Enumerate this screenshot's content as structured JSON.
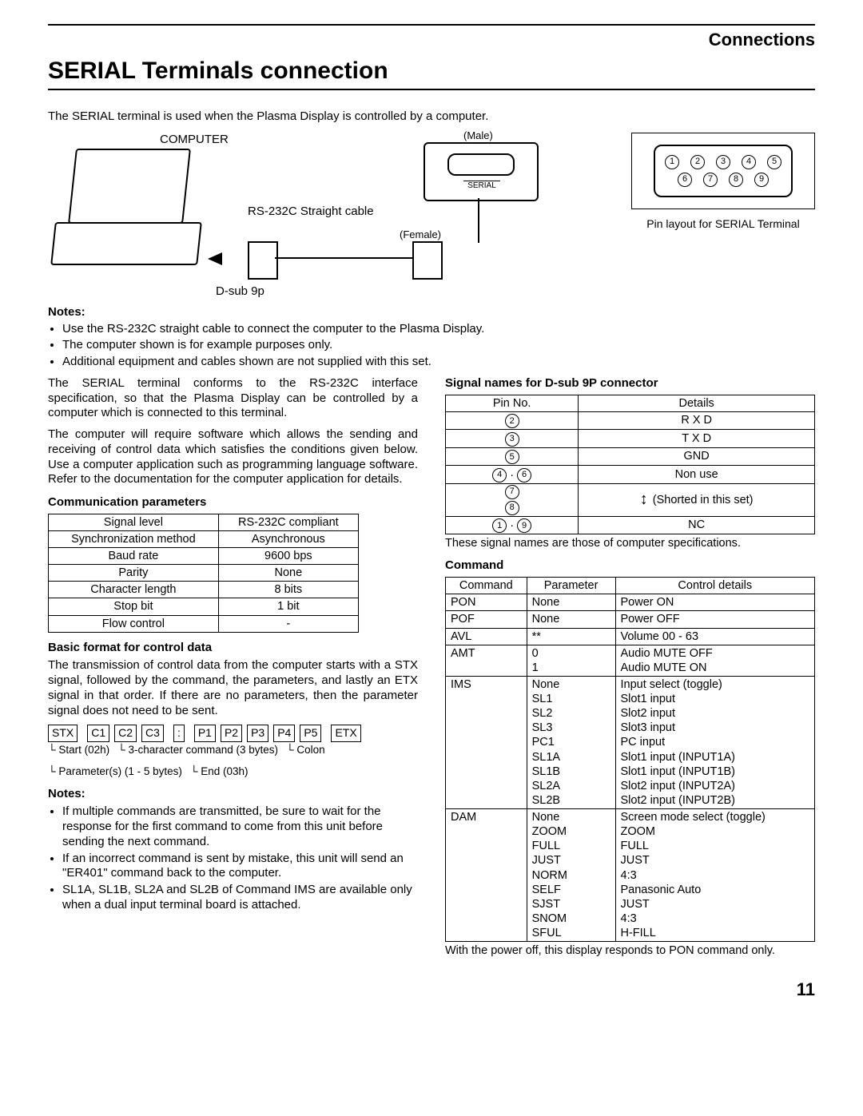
{
  "header": {
    "section": "Connections",
    "title": "SERIAL Terminals connection"
  },
  "intro_text": "The SERIAL terminal is used when the Plasma Display is controlled by a computer.",
  "diagram": {
    "computer_label": "COMPUTER",
    "male_label": "(Male)",
    "serial_label": "SERIAL",
    "cable_label": "RS-232C Straight cable",
    "female_label": "(Female)",
    "dsub_label": "D-sub 9p",
    "pin_caption": "Pin layout for SERIAL Terminal",
    "pins_top": [
      "1",
      "2",
      "3",
      "4",
      "5"
    ],
    "pins_bottom": [
      "6",
      "7",
      "8",
      "9"
    ]
  },
  "notes1_header": "Notes:",
  "notes1": [
    "Use the RS-232C straight cable to connect the computer to the Plasma Display.",
    "The computer shown is for example purposes only.",
    "Additional equipment and cables shown are not supplied with this set."
  ],
  "left_paras": [
    "The SERIAL terminal conforms to the RS-232C interface specification, so that the Plasma Display can be controlled by a computer which is connected to this terminal.",
    "The computer will require software which allows the sending and receiving of control data which satisfies the conditions given below. Use a computer application such as programming language software. Refer to the documentation for the computer application for details."
  ],
  "comm_header": "Communication parameters",
  "comm_params": [
    [
      "Signal level",
      "RS-232C compliant"
    ],
    [
      "Synchronization method",
      "Asynchronous"
    ],
    [
      "Baud rate",
      "9600 bps"
    ],
    [
      "Parity",
      "None"
    ],
    [
      "Character length",
      "8 bits"
    ],
    [
      "Stop bit",
      "1 bit"
    ],
    [
      "Flow control",
      "-"
    ]
  ],
  "basic_fmt_header": "Basic format for control data",
  "basic_fmt_text": "The transmission of control data from the computer starts with a STX signal, followed by the command, the parameters, and lastly an ETX signal in that order. If there are no parameters, then the parameter signal does not need to be sent.",
  "fmt_boxes": [
    "STX",
    "C1",
    "C2",
    "C3",
    ":",
    "P1",
    "P2",
    "P3",
    "P4",
    "P5",
    "ETX"
  ],
  "fmt_labels": {
    "start": "Start",
    "start_hex": "(02h)",
    "cmd": "3-character",
    "cmd2": "command (3 bytes)",
    "colon": "Colon",
    "params": "Parameter(s)",
    "params2": "(1 - 5 bytes)",
    "end": "End",
    "end_hex": "(03h)"
  },
  "notes2_header": "Notes:",
  "notes2": [
    "If multiple commands are transmitted, be sure to wait for the response for the first command to come from this unit before sending the next command.",
    "If an incorrect command is sent by mistake, this unit will send an \"ER401\" command back to the computer.",
    "SL1A, SL1B, SL2A and SL2B of Command IMS are available only when a dual input terminal board is attached."
  ],
  "signal_header": "Signal names for D-sub 9P connector",
  "signal_table": {
    "head": [
      "Pin No.",
      "Details"
    ],
    "rows": [
      {
        "pin": [
          "2"
        ],
        "detail": "R X D"
      },
      {
        "pin": [
          "3"
        ],
        "detail": "T X D"
      },
      {
        "pin": [
          "5"
        ],
        "detail": "GND"
      },
      {
        "pin": [
          "4",
          "6"
        ],
        "sep": "·",
        "detail": "Non use"
      },
      {
        "pin": [
          "7",
          "8"
        ],
        "stacked": true,
        "detail": "(Shorted in this set)",
        "bracket": true
      },
      {
        "pin": [
          "1",
          "9"
        ],
        "sep": "·",
        "detail": "NC"
      }
    ]
  },
  "signal_footnote": "These signal names are those of computer specifications.",
  "command_header": "Command",
  "command_table": {
    "head": [
      "Command",
      "Parameter",
      "Control details"
    ],
    "rows": [
      {
        "c": "PON",
        "p": [
          "None"
        ],
        "d": [
          "Power ON"
        ]
      },
      {
        "c": "POF",
        "p": [
          "None"
        ],
        "d": [
          "Power OFF"
        ]
      },
      {
        "c": "AVL",
        "p": [
          "**"
        ],
        "d": [
          "Volume 00 - 63"
        ]
      },
      {
        "c": "AMT",
        "p": [
          "0",
          "1"
        ],
        "d": [
          "Audio MUTE OFF",
          "Audio MUTE ON"
        ]
      },
      {
        "c": "IMS",
        "p": [
          "None",
          "SL1",
          "SL2",
          "SL3",
          "PC1",
          "SL1A",
          "SL1B",
          "SL2A",
          "SL2B"
        ],
        "d": [
          "Input select (toggle)",
          "Slot1 input",
          "Slot2 input",
          "Slot3 input",
          "PC input",
          "Slot1 input (INPUT1A)",
          "Slot1 input (INPUT1B)",
          "Slot2 input (INPUT2A)",
          "Slot2 input (INPUT2B)"
        ]
      },
      {
        "c": "DAM",
        "p": [
          "None",
          "ZOOM",
          "FULL",
          "JUST",
          "NORM",
          "SELF",
          "SJST",
          "SNOM",
          "SFUL"
        ],
        "d": [
          "Screen mode select (toggle)",
          "ZOOM",
          "FULL",
          "JUST",
          "4:3",
          "Panasonic Auto",
          "JUST",
          "4:3",
          "H-FILL"
        ]
      }
    ]
  },
  "command_footnote": "With the power off, this display responds to PON command only.",
  "page_number": "11"
}
